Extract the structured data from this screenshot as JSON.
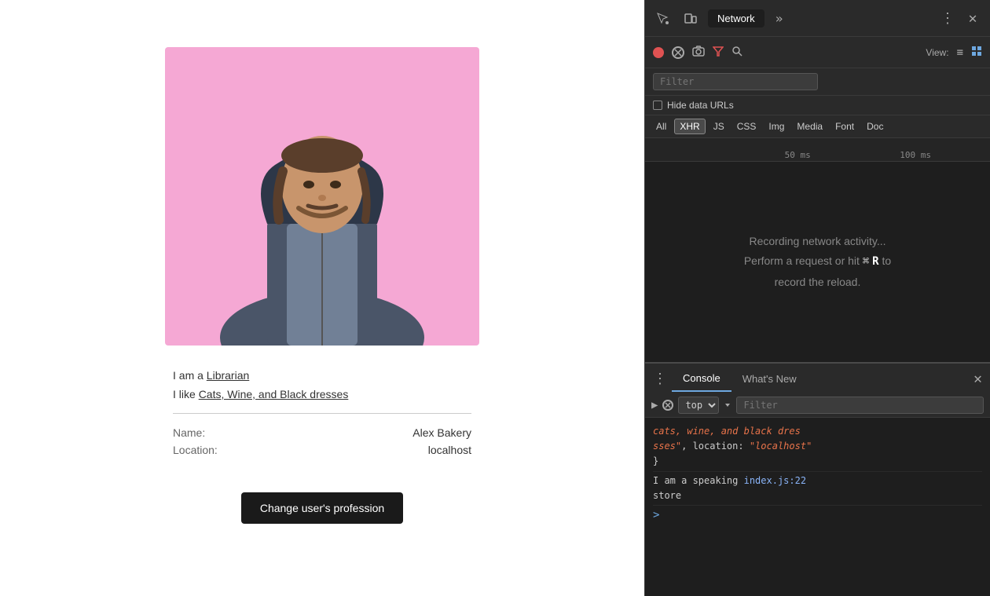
{
  "left": {
    "bio": {
      "profession_prefix": "I am a ",
      "profession": "Librarian",
      "likes_prefix": "I like ",
      "likes": "Cats, Wine, and Black dresses"
    },
    "details": {
      "name_label": "Name:",
      "name_value": "Alex Bakery",
      "location_label": "Location:",
      "location_value": "localhost"
    },
    "button_label": "Change user's profession"
  },
  "devtools": {
    "toolbar": {
      "tab_active": "Network",
      "overflow_label": "»",
      "more_label": "⋮",
      "close_label": "✕"
    },
    "network_toolbar": {
      "view_label": "View:",
      "list_icon": "☰",
      "grid_icon": "⊞"
    },
    "filter_placeholder": "Filter",
    "hide_data_urls_label": "Hide data URLs",
    "type_tabs": [
      "All",
      "XHR",
      "JS",
      "CSS",
      "Img",
      "Media",
      "Font",
      "Doc"
    ],
    "active_type_tab": "XHR",
    "timeline": {
      "mark1": "50 ms",
      "mark2": "100 ms"
    },
    "empty_state": {
      "line1": "Recording network activity...",
      "line2": "Perform a request or hit",
      "cmd_symbol": "⌘",
      "key": "R",
      "line2_end": "to",
      "line3": "record the reload."
    }
  },
  "console": {
    "tab_active": "Console",
    "tab_inactive": "What's New",
    "close_label": "✕",
    "context": "top",
    "filter_placeholder": "Filter",
    "log_lines": [
      {
        "text_red": "cats, wine, and black dres",
        "text2_red": "sses\"",
        "text_white": ", location: ",
        "text_string": "\"localhost\"",
        "close_brace": "}"
      }
    ],
    "log2_label": "I am a speaking ",
    "log2_link": "index.js:22",
    "log2_sub": "store",
    "prompt_symbol": ">"
  }
}
